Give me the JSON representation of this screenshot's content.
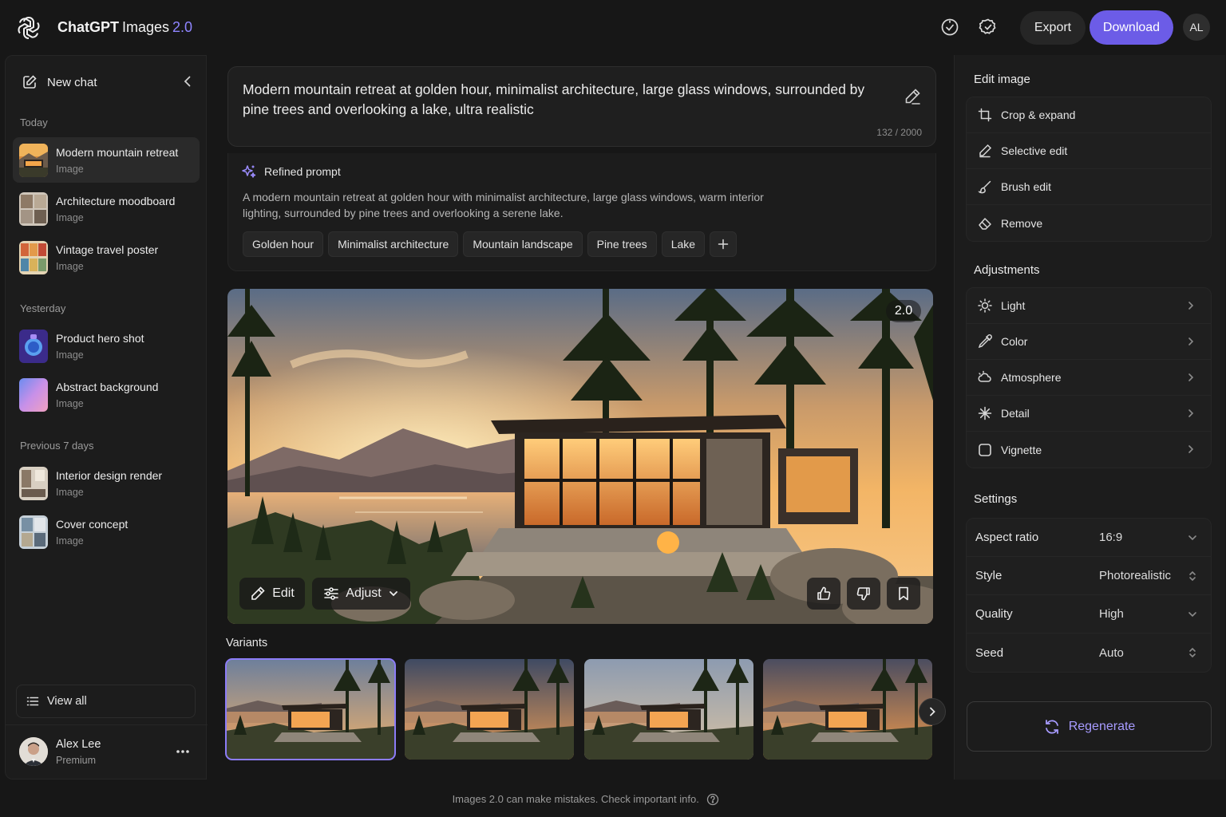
{
  "app": {
    "brand": "ChatGPT",
    "product": "Images",
    "version": "2.0",
    "accent_color": "#6c5ce7"
  },
  "topbar": {
    "icons": [
      "speed-check-icon",
      "settings-badge-icon"
    ],
    "export_label": "Export",
    "download_label": "Download",
    "user_initials": "AL"
  },
  "sidebar": {
    "new_chat_label": "New chat",
    "sections": [
      {
        "label": "Today",
        "items": [
          {
            "title": "Modern mountain retreat",
            "type": "Image",
            "active": true
          },
          {
            "title": "Architecture moodboard",
            "type": "Image"
          },
          {
            "title": "Vintage travel poster",
            "type": "Image"
          }
        ]
      },
      {
        "label": "Yesterday",
        "items": [
          {
            "title": "Product hero shot",
            "type": "Image"
          },
          {
            "title": "Abstract background",
            "type": "Image"
          }
        ]
      },
      {
        "label": "Previous 7 days",
        "items": [
          {
            "title": "Interior design render",
            "type": "Image"
          },
          {
            "title": "Cover concept",
            "type": "Image"
          }
        ]
      }
    ],
    "view_all_label": "View all",
    "user": {
      "name": "Alex Lee",
      "plan": "Premium"
    }
  },
  "prompt": {
    "text": "Modern mountain retreat at golden hour, minimalist architecture, large glass windows, surrounded by pine trees and overlooking a lake, ultra realistic",
    "count": "132 / 2000"
  },
  "refined": {
    "label": "Refined prompt",
    "text": "A modern mountain retreat at golden hour with minimalist architecture, large glass windows, warm interior lighting, surrounded by pine trees and overlooking a serene lake.",
    "chips": [
      "Golden hour",
      "Minimalist architecture",
      "Mountain landscape",
      "Pine trees",
      "Lake"
    ]
  },
  "image": {
    "version_badge": "2.0",
    "edit_label": "Edit",
    "adjust_label": "Adjust"
  },
  "variants": {
    "label": "Variants",
    "selected_index": 0
  },
  "edit_panel": {
    "title": "Edit image",
    "items": [
      {
        "label": "Crop & expand",
        "icon": "crop-icon"
      },
      {
        "label": "Selective edit",
        "icon": "pencil-icon"
      },
      {
        "label": "Brush edit",
        "icon": "brush-icon"
      },
      {
        "label": "Remove",
        "icon": "eraser-icon"
      }
    ]
  },
  "adjustments": {
    "title": "Adjustments",
    "items": [
      {
        "label": "Light",
        "icon": "sun-icon"
      },
      {
        "label": "Color",
        "icon": "dropper-icon"
      },
      {
        "label": "Atmosphere",
        "icon": "cloud-icon"
      },
      {
        "label": "Detail",
        "icon": "sparkle-icon"
      },
      {
        "label": "Vignette",
        "icon": "square-icon"
      }
    ]
  },
  "settings": {
    "title": "Settings",
    "rows": [
      {
        "label": "Aspect ratio",
        "value": "16:9",
        "control": "dropdown"
      },
      {
        "label": "Style",
        "value": "Photorealistic",
        "control": "updown"
      },
      {
        "label": "Quality",
        "value": "High",
        "control": "dropdown"
      },
      {
        "label": "Seed",
        "value": "Auto",
        "control": "updown"
      }
    ]
  },
  "regenerate_label": "Regenerate",
  "footer": {
    "note": "Images 2.0 can make mistakes. Check important info."
  }
}
